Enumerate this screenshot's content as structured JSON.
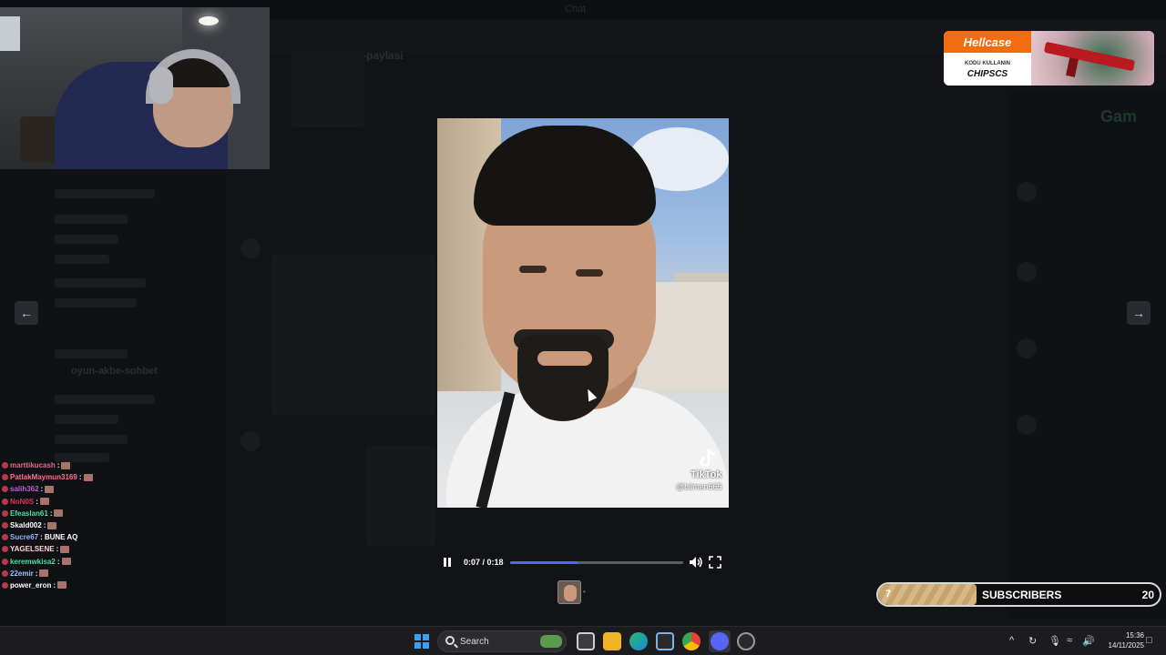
{
  "background_app": {
    "window_title": "Chat",
    "channel_name": "e63-foto-akbe-paylasi",
    "channel_list_item": "oyun-akbe-sohbet",
    "right_brand": "Gam"
  },
  "ad": {
    "brand": "Hellcase",
    "tagline": "KODU KULLANIN",
    "code": "CHIPSCS"
  },
  "media": {
    "watermark": "TikTok",
    "watermark_user": "@bilmen665",
    "current_time": "0:07",
    "duration": "0:18",
    "time_display": "0:07 / 0:18",
    "progress": 0.39
  },
  "stream_chat": [
    {
      "user": "marttikucash",
      "message": "",
      "color": "#e06c8a"
    },
    {
      "user": "PatlakMaymun3169",
      "message": "",
      "color": "#ff6f91"
    },
    {
      "user": "salih362",
      "message": "",
      "color": "#c45bd6"
    },
    {
      "user": "NoN0S",
      "message": "",
      "color": "#e0334f"
    },
    {
      "user": "Efeaslan61",
      "message": "",
      "color": "#4ddfa0"
    },
    {
      "user": "Skald002",
      "message": "",
      "color": "#ffffff"
    },
    {
      "user": "Sucre67",
      "message": "BUNE AQ",
      "color": "#8fb8ff"
    },
    {
      "user": "YAGELSENE",
      "message": "",
      "color": "#ffd1dc"
    },
    {
      "user": "keremwkisa2",
      "message": "",
      "color": "#4ddfa0"
    },
    {
      "user": "22emir",
      "message": "",
      "color": "#9fc2ff"
    },
    {
      "user": "power_eron",
      "message": "",
      "color": "#ffffff"
    }
  ],
  "subscribers": {
    "count": "7",
    "label": "SUBSCRIBERS",
    "goal": "20",
    "progress": 0.35
  },
  "taskbar": {
    "search_placeholder": "Search",
    "time": "15:36",
    "date": "14/11/2025"
  },
  "colors": {
    "accent": "#5865f2",
    "hellcase_orange": "#f26d0f",
    "taskbar_bg": "#1c1c1f"
  }
}
